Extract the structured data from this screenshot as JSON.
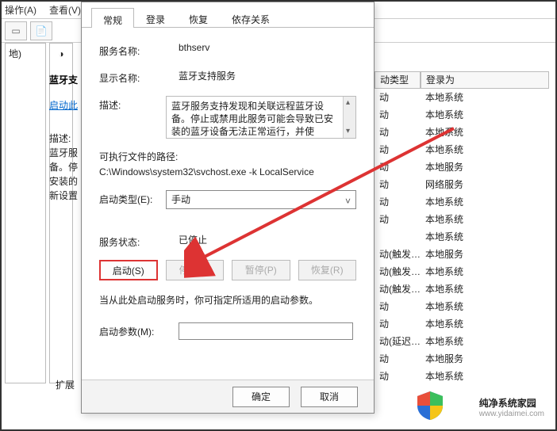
{
  "menu": {
    "op": "操作(A)",
    "view": "查看(V)"
  },
  "left_tree": "地)",
  "mid_icon": "◑",
  "side_title": "蓝牙支",
  "side_start": "启动此",
  "side_desc": "描述:\n蓝牙服\n备。停\n安装的\n新设置",
  "extended": "扩展",
  "tabs": {
    "general": "常规",
    "logon": "登录",
    "recovery": "恢复",
    "deps": "依存关系"
  },
  "labels": {
    "service_name": "服务名称:",
    "display_name": "显示名称:",
    "description": "描述:",
    "exe_path": "可执行文件的路径:",
    "startup_type": "启动类型(E):",
    "service_state": "服务状态:",
    "hint": "当从此处启动服务时，你可指定所适用的启动参数。",
    "start_params": "启动参数(M):"
  },
  "values": {
    "service_name": "bthserv",
    "display_name": "蓝牙支持服务",
    "description": "蓝牙服务支持发现和关联远程蓝牙设备。停止或禁用此服务可能会导致已安装的蓝牙设备无法正常运行，并使",
    "exe_path": "C:\\Windows\\system32\\svchost.exe -k LocalService",
    "startup_type": "手动",
    "service_state": "已停止"
  },
  "buttons": {
    "start": "启动(S)",
    "stop": "停止(T)",
    "pause": "暂停(P)",
    "resume": "恢复(R)",
    "ok": "确定",
    "cancel": "取消"
  },
  "svc_head": {
    "starttype": "动类型",
    "logon": "登录为"
  },
  "svc_rows": [
    {
      "t": "动",
      "l": "本地系统"
    },
    {
      "t": "动",
      "l": "本地系统"
    },
    {
      "t": "动",
      "l": "本地系统"
    },
    {
      "t": "动",
      "l": "本地系统"
    },
    {
      "t": "动",
      "l": "本地服务"
    },
    {
      "t": "动",
      "l": "网络服务"
    },
    {
      "t": "动",
      "l": "本地系统"
    },
    {
      "t": "动",
      "l": "本地系统"
    },
    {
      "t": "",
      "l": "本地系统"
    },
    {
      "t": "动(触发…",
      "l": "本地服务"
    },
    {
      "t": "动(触发…",
      "l": "本地系统"
    },
    {
      "t": "动(触发…",
      "l": "本地系统"
    },
    {
      "t": "动",
      "l": "本地系统"
    },
    {
      "t": "动",
      "l": "本地系统"
    },
    {
      "t": "动(延迟…",
      "l": "本地系统"
    },
    {
      "t": "动",
      "l": "本地服务"
    },
    {
      "t": "动",
      "l": "本地系统"
    }
  ],
  "brand": {
    "name": "纯净系统家园",
    "url": "www.yidaimei.com"
  }
}
